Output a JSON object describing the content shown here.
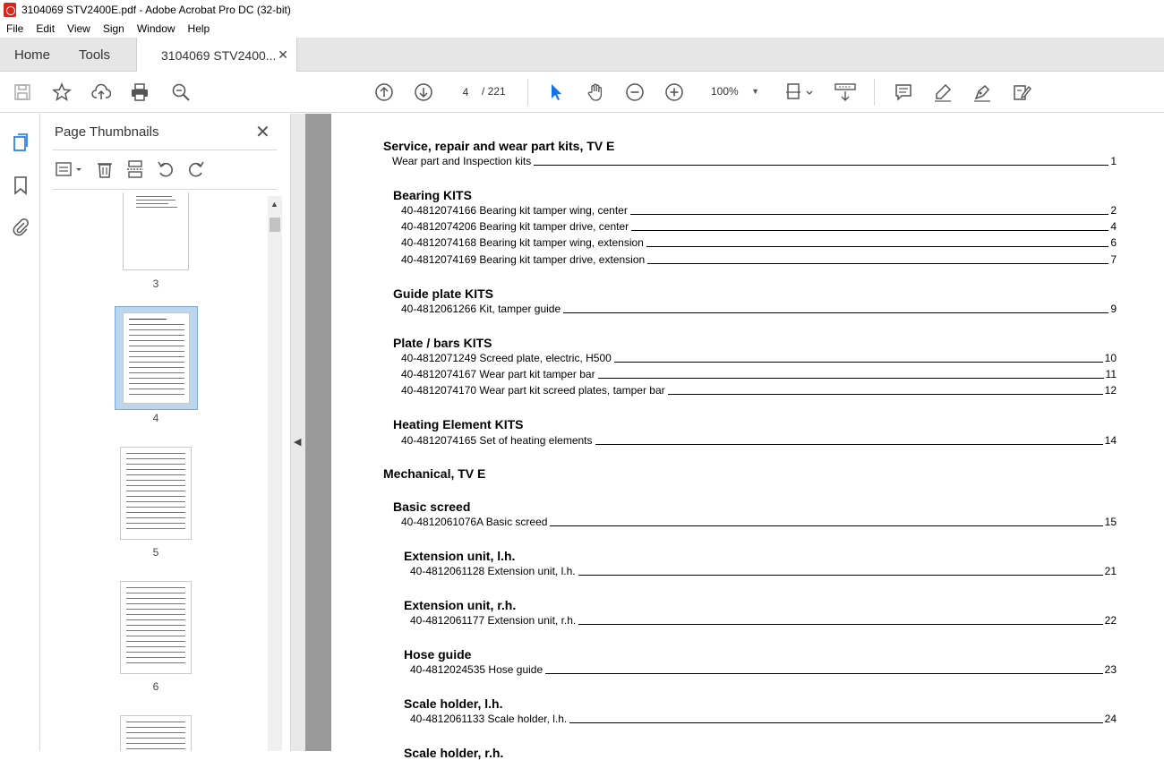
{
  "window_title": "3104069 STV2400E.pdf - Adobe Acrobat Pro DC (32-bit)",
  "menu": [
    "File",
    "Edit",
    "View",
    "Sign",
    "Window",
    "Help"
  ],
  "tabs": {
    "home": "Home",
    "tools": "Tools",
    "doc": "3104069 STV2400..."
  },
  "toolbar": {
    "current_page": "4",
    "page_sep": "/ 221",
    "zoom": "100%"
  },
  "panel": {
    "title": "Page Thumbnails",
    "thumbnails": [
      {
        "label": "3"
      },
      {
        "label": "4",
        "selected": true
      },
      {
        "label": "5"
      },
      {
        "label": "6"
      }
    ]
  },
  "toc": {
    "sections": [
      {
        "title": "Service, repair and wear part kits, TV E",
        "entries": [
          {
            "text": "Wear part and Inspection kits",
            "page": "1"
          }
        ]
      },
      {
        "title": "Bearing KITS",
        "entries": [
          {
            "text": "40-4812074166 Bearing kit tamper wing, center",
            "page": "2"
          },
          {
            "text": "40-4812074206 Bearing kit tamper drive, center",
            "page": "4"
          },
          {
            "text": "40-4812074168 Bearing kit tamper wing, extension",
            "page": "6"
          },
          {
            "text": "40-4812074169 Bearing kit tamper drive, extension",
            "page": "7"
          }
        ]
      },
      {
        "title": "Guide plate KITS",
        "entries": [
          {
            "text": "40-4812061266 Kit, tamper guide",
            "page": "9"
          }
        ]
      },
      {
        "title": "Plate / bars KITS",
        "entries": [
          {
            "text": "40-4812071249 Screed plate, electric, H500",
            "page": "10"
          },
          {
            "text": "40-4812074167 Wear part kit tamper bar",
            "page": "11"
          },
          {
            "text": "40-4812074170 Wear part kit screed plates, tamper bar",
            "page": "12"
          }
        ]
      },
      {
        "title": "Heating Element KITS",
        "entries": [
          {
            "text": "40-4812074165 Set of heating elements",
            "page": "14"
          }
        ]
      },
      {
        "title": "Mechanical, TV E",
        "entries": []
      },
      {
        "title": "Basic screed",
        "entries": [
          {
            "text": "40-4812061076A Basic screed",
            "page": "15"
          }
        ]
      },
      {
        "title": "Extension unit, l.h.",
        "entries": [
          {
            "text": "40-4812061128 Extension unit, l.h.",
            "page": "21"
          }
        ]
      },
      {
        "title": "Extension unit, r.h.",
        "entries": [
          {
            "text": "40-4812061177 Extension unit, r.h.",
            "page": "22"
          }
        ]
      },
      {
        "title": "Hose guide",
        "entries": [
          {
            "text": "40-4812024535 Hose guide",
            "page": "23"
          }
        ]
      },
      {
        "title": "Scale holder, l.h.",
        "entries": [
          {
            "text": "40-4812061133 Scale holder, l.h.",
            "page": "24"
          }
        ]
      },
      {
        "title": "Scale holder, r.h.",
        "entries": []
      }
    ]
  }
}
